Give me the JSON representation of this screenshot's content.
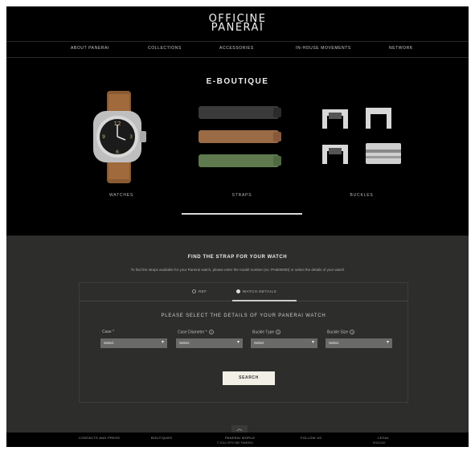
{
  "brand": {
    "line1": "OFFICINE",
    "line2": "PANERAI"
  },
  "nav": [
    "ABOUT PANERAI",
    "COLLECTIONS",
    "ACCESSORIES",
    "IN-HOUSE MOVEMENTS",
    "NETWORK"
  ],
  "eboutique": {
    "title": "E-BOUTIQUE",
    "categories": [
      "WATCHES",
      "STRAPS",
      "BUCKLES"
    ]
  },
  "finder": {
    "title": "FIND THE STRAP FOR YOUR WATCH",
    "description": "To find the straps available for your Panerai watch, please enter the model number (ex: PAM00000) or select the details of your watch",
    "tabs": [
      "REF",
      "WATCH DETAILS"
    ],
    "select_title": "PLEASE SELECT THE DETAILS OF YOUR PANERAI WATCH",
    "fields": [
      {
        "label": "Case *",
        "value": "Select"
      },
      {
        "label": "Case Diameter *",
        "value": "Select"
      },
      {
        "label": "Buckle Type",
        "value": "Select"
      },
      {
        "label": "Buckle Size",
        "value": "Select"
      }
    ],
    "search_label": "SEARCH"
  },
  "footer": {
    "items": [
      "CONTACTS AND PRESS",
      "BOUTIQUES",
      "PANERAI WORLD",
      "FOLLOW US",
      "LEGAL"
    ],
    "copyright": "© 2014 OFFICINE PANERAI",
    "language": "ENGLISH"
  },
  "colors": {
    "background": "#000000",
    "panel": "#2d2d2b",
    "accent": "#f2efe6"
  },
  "icons": {
    "back_to_top": "chevron-up-icon",
    "help": "question-circle-icon"
  }
}
